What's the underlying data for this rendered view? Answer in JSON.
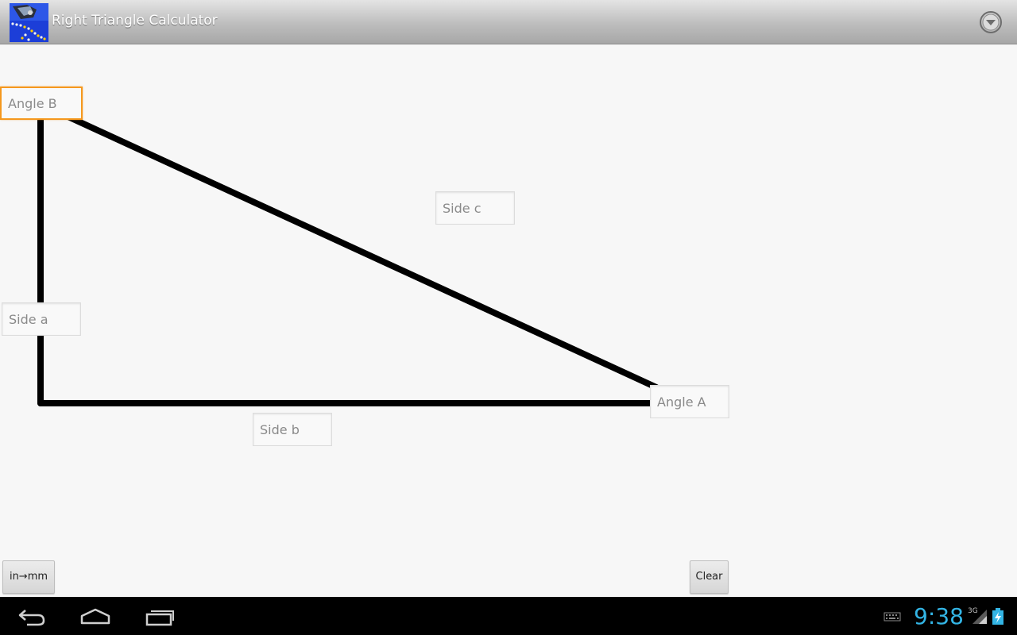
{
  "app": {
    "title": "Right Triangle Calculator",
    "icon_name": "app-logo-icon",
    "overflow_icon_name": "overflow-menu-icon"
  },
  "fields": {
    "angle_b": {
      "placeholder": "Angle B",
      "value": "",
      "focused": true
    },
    "side_c": {
      "placeholder": "Side c",
      "value": ""
    },
    "side_a": {
      "placeholder": "Side a",
      "value": ""
    },
    "angle_a": {
      "placeholder": "Angle A",
      "value": ""
    },
    "side_b": {
      "placeholder": "Side b",
      "value": ""
    }
  },
  "buttons": {
    "convert_label": "in→mm",
    "clear_label": "Clear"
  },
  "status_bar": {
    "time": "9:38",
    "network_type": "3G",
    "icons": [
      "back-icon",
      "home-icon",
      "recent-apps-icon",
      "keyboard-icon",
      "signal-icon",
      "battery-charging-icon"
    ]
  },
  "colors": {
    "accent_focus": "#f5981e",
    "clock": "#33b5e5",
    "triangle_stroke": "#000000",
    "background": "#f7f7f7"
  }
}
